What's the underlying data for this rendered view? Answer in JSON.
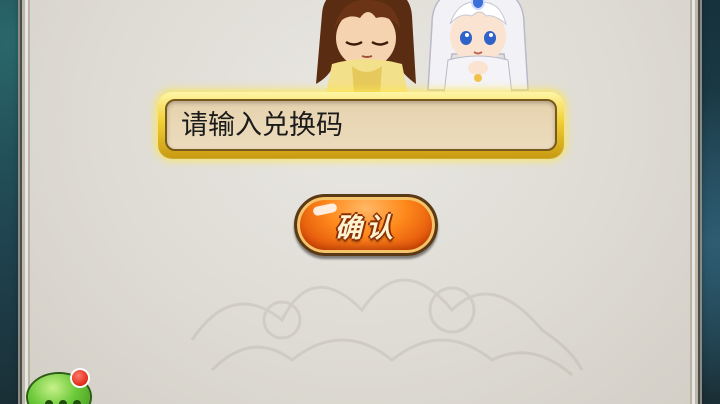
{
  "redeem": {
    "input_value": "",
    "input_placeholder": "请输入兑换码",
    "confirm_label": "确认"
  },
  "characters": [
    {
      "icon": "swordsman-character-icon"
    },
    {
      "icon": "priestess-character-icon"
    }
  ],
  "chat": {
    "icon": "chat-bubble-icon",
    "has_notification": true
  },
  "colors": {
    "panel": "#dedbd4",
    "input_glow": "#f1cf35",
    "button_orange": "#ff8a1c",
    "chat_green": "#6cc93a",
    "badge_red": "#e02a18"
  }
}
